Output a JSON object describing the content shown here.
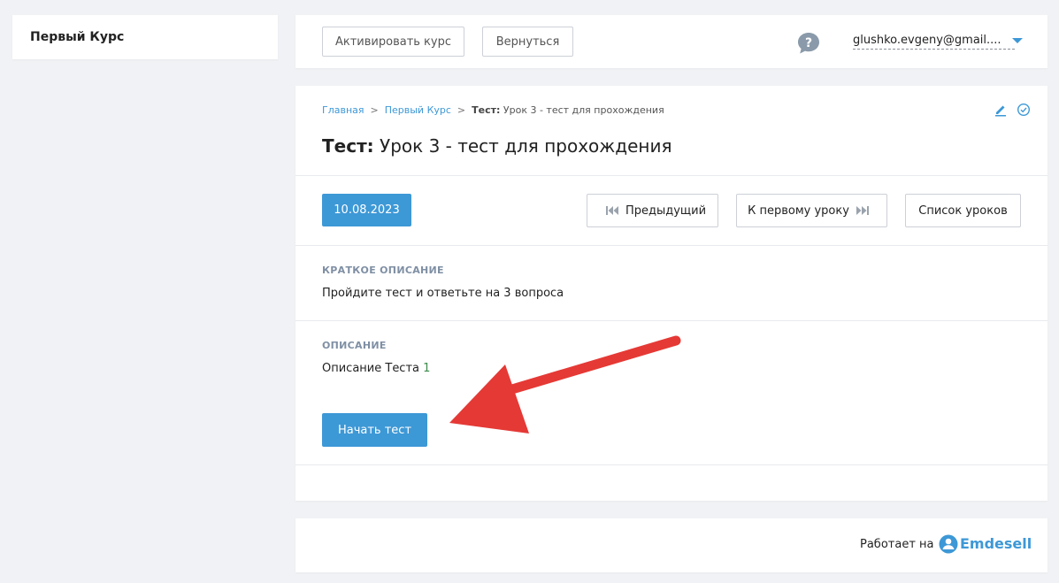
{
  "sidebar": {
    "course_title": "Первый Курс"
  },
  "header": {
    "activate_label": "Активировать курс",
    "back_label": "Вернуться",
    "help_icon": "help-bubble-icon",
    "user_email": "glushko.evgeny@gmail...."
  },
  "breadcrumb": {
    "home": "Главная",
    "course": "Первый Курс",
    "current_prefix": "Тест:",
    "current": "Урок 3 - тест для прохождения",
    "separator": ">"
  },
  "page": {
    "title_prefix": "Тест:",
    "title": "Урок 3 - тест для прохождения",
    "date": "10.08.2023"
  },
  "nav": {
    "prev_label": "Предыдущий",
    "first_label": "К первому уроку",
    "list_label": "Список уроков"
  },
  "short_description": {
    "label": "КРАТКОЕ ОПИСАНИЕ",
    "text": "Пройдите тест и ответьте на 3 вопроса"
  },
  "description": {
    "label": "ОПИСАНИЕ",
    "text": "Описание Теста",
    "number": "1"
  },
  "start_button": {
    "label": "Начать тест"
  },
  "footer": {
    "powered_by": "Работает на",
    "brand": "Emdesell"
  },
  "colors": {
    "accent": "#3d98d6",
    "annotation": "#e53935",
    "label": "#7f8fa4"
  }
}
